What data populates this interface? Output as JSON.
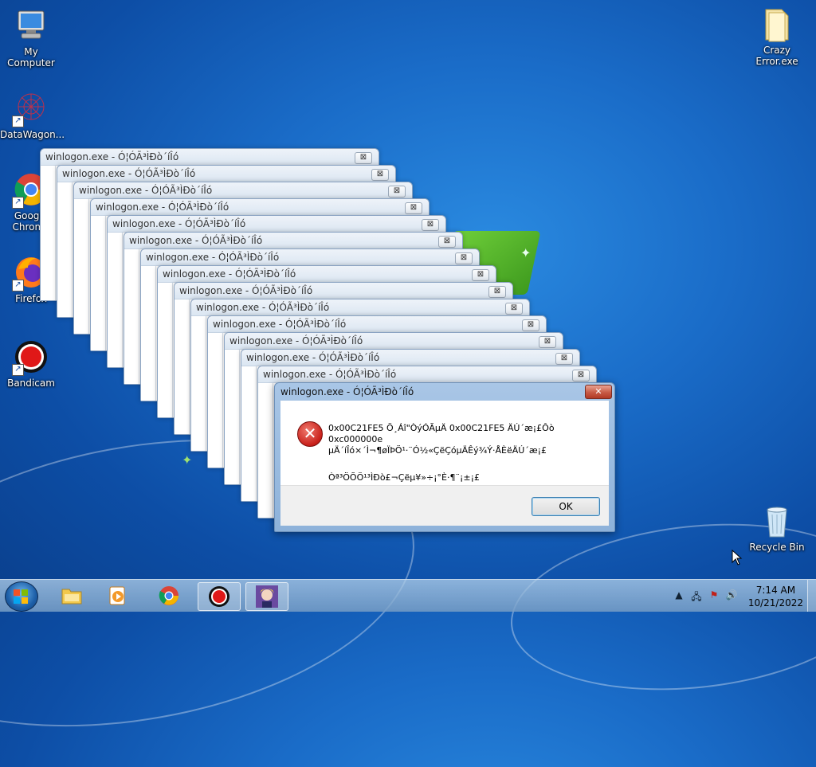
{
  "desktop": {
    "icons": [
      {
        "label": "My Computer",
        "icon": "computer-icon"
      },
      {
        "label": "DataWagon...",
        "icon": "datawagon-icon"
      },
      {
        "label": "Google Chrome",
        "icon": "chrome-icon"
      },
      {
        "label": "Firefox",
        "icon": "firefox-icon"
      },
      {
        "label": "Bandicam",
        "icon": "bandicam-icon"
      },
      {
        "label": "Crazy Error.exe",
        "icon": "folder-icon"
      },
      {
        "label": "Recycle Bin",
        "icon": "recycle-bin-icon"
      }
    ],
    "chrome_label_line1": "Google",
    "chrome_label_line2": "Chrome",
    "crazy_line1": "Crazy",
    "crazy_line2": "Error.exe"
  },
  "stack_window_title": "winlogon.exe - Ó¦ÓÃ³ÌÐò´íÎó",
  "stack_close_glyph": "⊠",
  "dialog": {
    "title": "winlogon.exe - Ó¦ÓÃ³ÌÐò´íÎó",
    "close_glyph": "✕",
    "icon": "error-icon",
    "message_line1": "0x00C21FE5 Ö¸Áî\"ÒýÓÃµÄ 0x00C21FE5 ÄÚ´æ¡£Ôò 0xc000000e",
    "message_line2": "µÄ´íÎó×´Ì¬¶øÏÞÖ¹·¨Ó½«ÇëÇóµÄÊý¾Ý·ÅÈëÄÚ´æ¡£",
    "message_line3": "Òª³ÖÕÖ¹³ÌÐò£¬Çëµ¥»÷¡°È·¶¨¡±¡£",
    "ok_label": "OK"
  },
  "taskbar": {
    "start": "start-button",
    "buttons": [
      {
        "name": "explorer-icon",
        "active": false
      },
      {
        "name": "media-player-icon",
        "active": false
      },
      {
        "name": "chrome-icon",
        "active": false
      },
      {
        "name": "bandicam-icon",
        "active": true
      },
      {
        "name": "anime-app-icon",
        "active": true
      }
    ],
    "clock_time": "7:14 AM",
    "clock_date": "10/21/2022"
  },
  "colors": {
    "accent": "#1a6cc8",
    "error_red": "#c8201a"
  }
}
